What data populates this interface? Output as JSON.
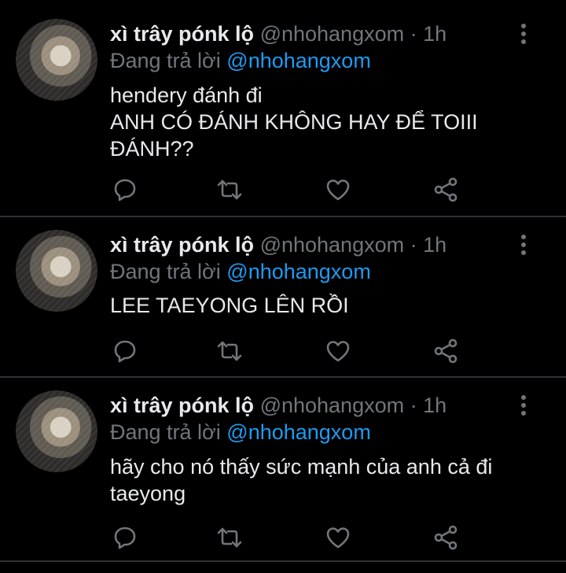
{
  "tweets": [
    {
      "name": "xì trây pónk lộ",
      "handle": "@nhohangxom",
      "separator": "·",
      "time": "1h",
      "reply_prefix": "Đang trả lời",
      "reply_to": "@nhohangxom",
      "lines": [
        "hendery đánh đi",
        "ANH CÓ ĐÁNH KHÔNG HAY ĐỂ TOIII",
        "ĐÁNH??"
      ]
    },
    {
      "name": "xì trây pónk lộ",
      "handle": "@nhohangxom",
      "separator": "·",
      "time": "1h",
      "reply_prefix": "Đang trả lời",
      "reply_to": "@nhohangxom",
      "lines": [
        "LEE TAEYONG LÊN RỒI"
      ]
    },
    {
      "name": "xì trây pónk lộ",
      "handle": "@nhohangxom",
      "separator": "·",
      "time": "1h",
      "reply_prefix": "Đang trả lời",
      "reply_to": "@nhohangxom",
      "lines": [
        "hãy cho nó thấy sức mạnh của anh cả đi",
        "taeyong"
      ]
    }
  ],
  "icons": {
    "reply": "reply-icon",
    "retweet": "retweet-icon",
    "like": "heart-icon",
    "share": "share-icon",
    "more": "more-vertical-icon"
  },
  "colors": {
    "background": "#000000",
    "text": "#e7e9ea",
    "secondary": "#71767b",
    "mention": "#1d9bf0",
    "divider": "#2f3336"
  }
}
